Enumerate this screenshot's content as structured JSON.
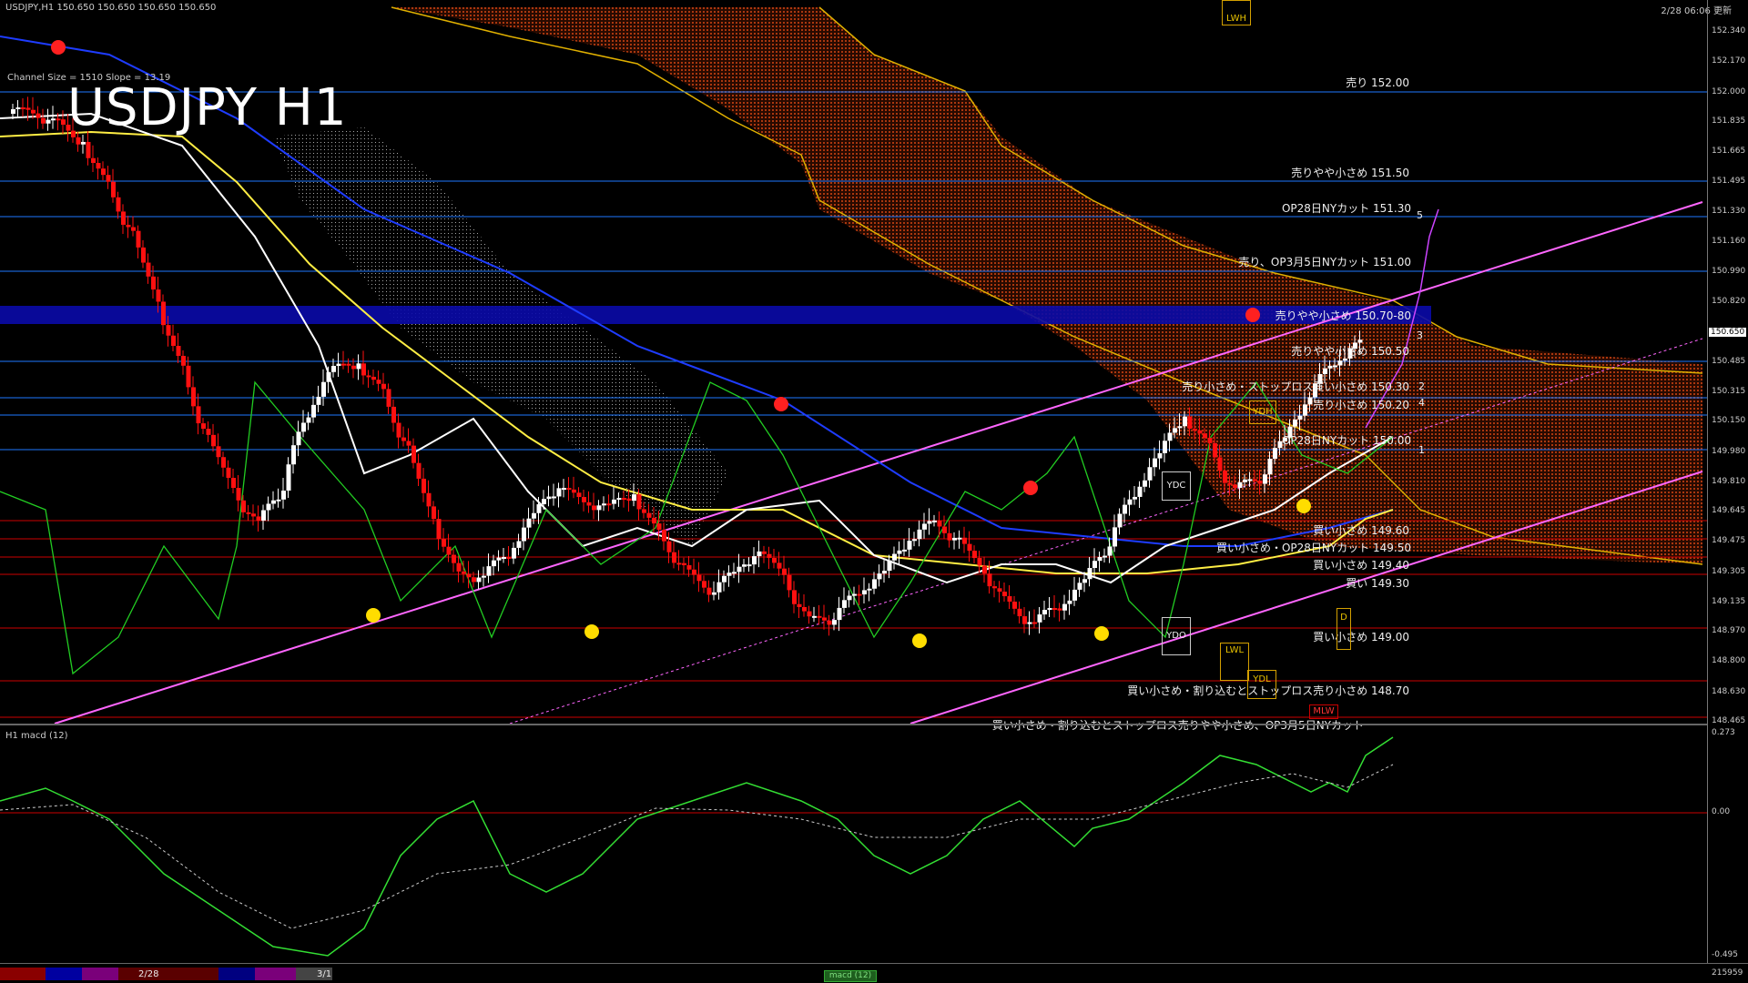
{
  "header": {
    "symbol_info": "USDJPY,H1  150.650 150.650 150.650 150.650",
    "datetime": "2/28 06:06 更新",
    "channel_info": "Channel Size = 1510 Slope = 13.19",
    "title": "USDJPY H1"
  },
  "price_axis": {
    "ticks": [
      "152.340",
      "152.170",
      "152.000",
      "151.835",
      "151.665",
      "151.495",
      "151.330",
      "151.160",
      "150.990",
      "150.820",
      "150.650",
      "150.485",
      "150.315",
      "150.150",
      "149.980",
      "149.810",
      "149.645",
      "149.475",
      "149.305",
      "149.135",
      "148.970",
      "148.800",
      "148.630",
      "148.465"
    ],
    "current": "150.650"
  },
  "levels": [
    {
      "text": "売り 152.00"
    },
    {
      "text": "売りやや小さめ 151.50"
    },
    {
      "text": "OP28日NYカット 151.30"
    },
    {
      "text": "売り、OP3月5日NYカット 151.00"
    },
    {
      "text": "売りやや小さめ 150.70-80"
    },
    {
      "text": "売りやや小さめ 150.50"
    },
    {
      "text": "売り小さめ・ストップロス買い小さめ 150.30"
    },
    {
      "text": "売り小さめ 150.20"
    },
    {
      "text": "OP28日NYカット 150.00"
    },
    {
      "text": "買い小さめ 149.60"
    },
    {
      "text": "買い小さめ・OP28日NYカット 149.50"
    },
    {
      "text": "買い小さめ 149.40"
    },
    {
      "text": "買い 149.30"
    },
    {
      "text": "買い小さめ 149.00"
    },
    {
      "text": "買い小さめ・割り込むとストップロス売り小さめ 148.70"
    },
    {
      "text": "買い小さめ・割り込むとストップロス売りやや小さめ、OP3月5日NYカット"
    }
  ],
  "waves": [
    "5",
    "3",
    "2",
    "4",
    "1"
  ],
  "boxes": {
    "lwh": "LWH",
    "ydh": "YDH",
    "ydc": "YDC",
    "ydo": "YDO",
    "lwl": "LWL",
    "ydl": "YDL",
    "d": "D",
    "mlw": "MLW"
  },
  "indicator": {
    "label": "H1  macd (12)",
    "ticks": [
      "0.273",
      "0.00",
      "-0.495"
    ]
  },
  "bottom": {
    "dates": [
      "2/28",
      "3/1"
    ],
    "tab": "macd (12)",
    "volume": "215959"
  },
  "colors": {
    "background": "#000000",
    "cloud": "#8b2500",
    "channel": "#ff66ff",
    "ma_blue": "#1e3cff",
    "ma_yellow": "#ffee44",
    "ma_white": "#ffffff",
    "bull": "#ffffff",
    "bear": "#ff1010",
    "level_blue": "#1e78ff",
    "level_red": "#cc0000",
    "macd_green": "#33dd33",
    "macd_pink": "#ff88aa"
  }
}
